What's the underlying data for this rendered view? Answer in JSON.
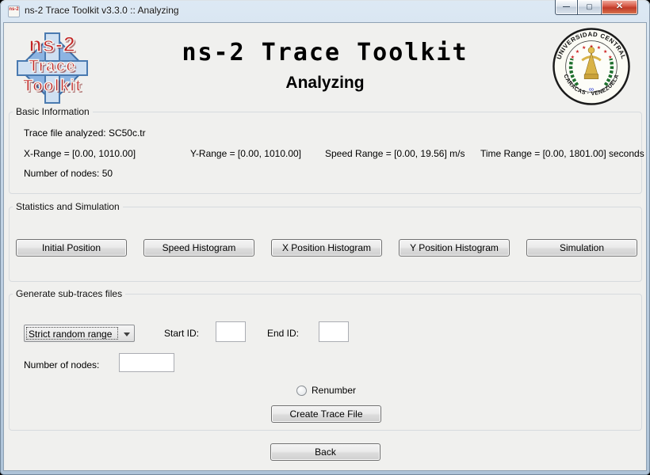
{
  "window": {
    "title": "ns-2 Trace Toolkit v3.3.0 :: Analyzing",
    "controls": {
      "minimize_glyph": "—",
      "maximize_glyph": "▢",
      "close_glyph": "✕"
    }
  },
  "header": {
    "title": "ns-2 Trace Toolkit",
    "subtitle": "Analyzing",
    "logo": {
      "line1": "ns-2",
      "line2": "Trace",
      "line3": "Toolkit"
    },
    "seal": {
      "top_text": "UNIVERSIDAD CENTRAL",
      "bottom_text": "CARACAS · VENEZUELA"
    }
  },
  "basic_info": {
    "legend": "Basic Information",
    "trace_file": "Trace file analyzed: SC50c.tr",
    "x_range": "X-Range = [0.00, 1010.00]",
    "y_range": "Y-Range = [0.00, 1010.00]",
    "speed_range": "Speed Range = [0.00, 19.56] m/s",
    "time_range": "Time Range = [0.00, 1801.00] seconds",
    "num_nodes": "Number of nodes: 50"
  },
  "statistics": {
    "legend": "Statistics and Simulation",
    "buttons": [
      "Initial Position",
      "Speed Histogram",
      "X Position Histogram",
      "Y Position Histogram",
      "Simulation"
    ]
  },
  "subtraces": {
    "legend": "Generate sub-traces files",
    "mode_selected": "Strict random range",
    "start_id_label": "Start ID:",
    "start_id_value": "",
    "end_id_label": "End ID:",
    "end_id_value": "",
    "num_nodes_label": "Number of nodes:",
    "num_nodes_value": "",
    "renumber_label": "Renumber",
    "renumber_checked": false,
    "create_button": "Create Trace File"
  },
  "footer": {
    "back_button": "Back"
  },
  "colors": {
    "frame_blue": "#b6c8dc",
    "content_bg": "#f0f0ee",
    "close_red": "#c03a28",
    "logo_red": "#c32424",
    "logo_blue": "#8cb4e2",
    "seal_green": "#1e6f2d",
    "seal_gold": "#d9b347",
    "seal_star_red": "#cc1f1f"
  }
}
